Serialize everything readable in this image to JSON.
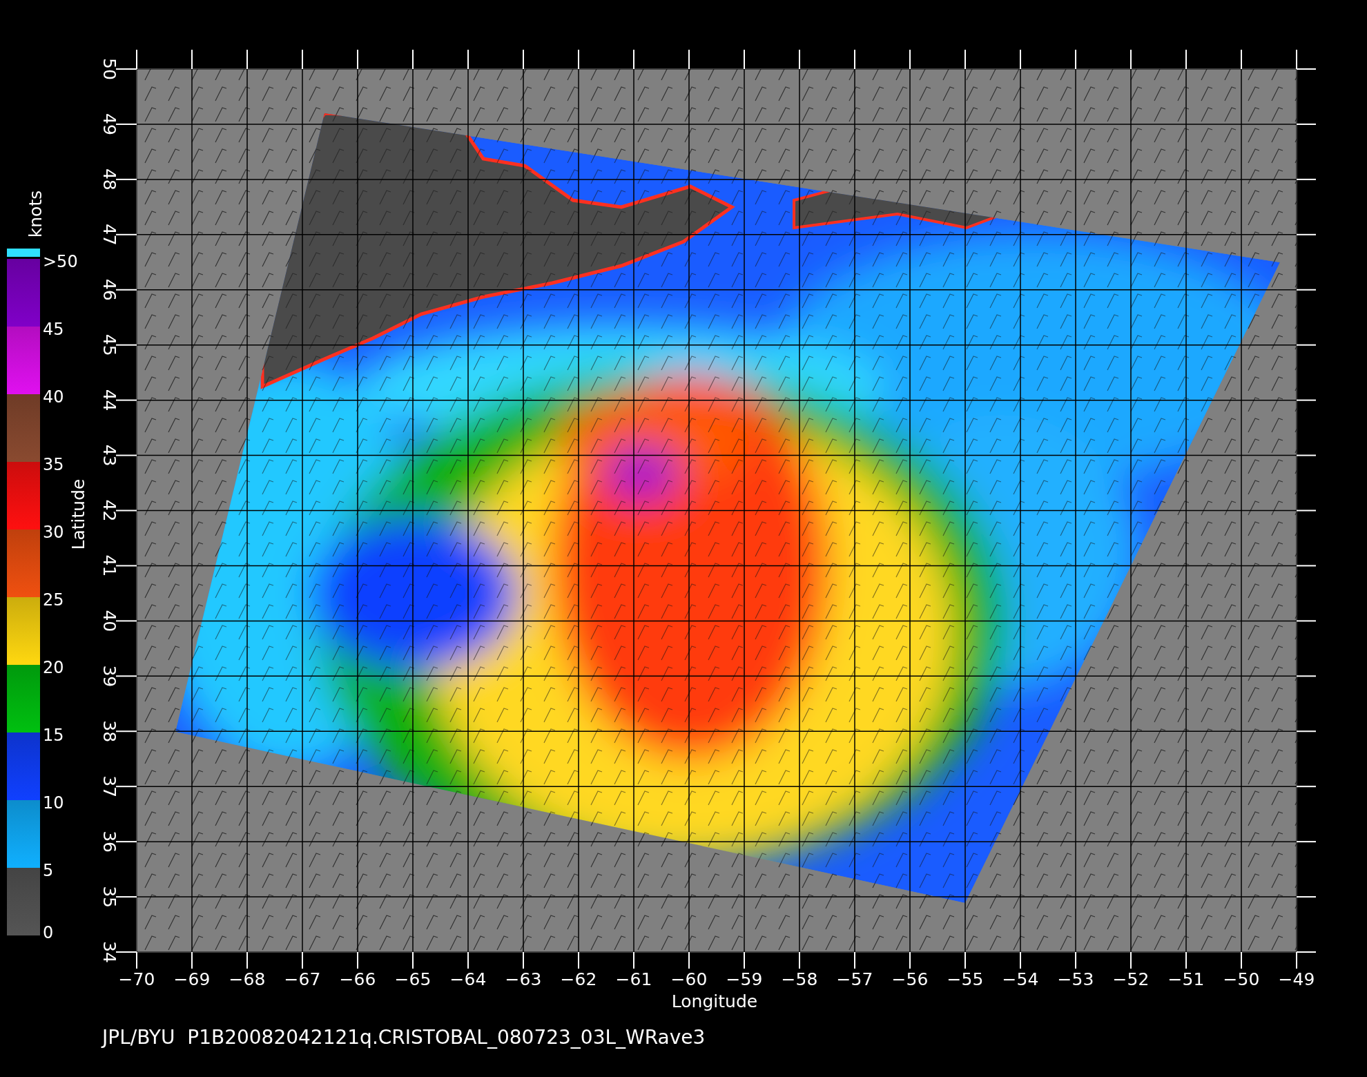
{
  "plot": {
    "x_axis": {
      "title": "Longitude",
      "ticks": [
        "−70",
        "−69",
        "−68",
        "−67",
        "−66",
        "−65",
        "−64",
        "−63",
        "−62",
        "−61",
        "−60",
        "−59",
        "−58",
        "−57",
        "−56",
        "−55",
        "−54",
        "−53",
        "−52",
        "−51",
        "−50",
        "−49"
      ]
    },
    "y_axis": {
      "title": "Latitude",
      "ticks": [
        "34",
        "35",
        "36",
        "37",
        "38",
        "39",
        "40",
        "41",
        "42",
        "43",
        "44",
        "45",
        "46",
        "47",
        "48",
        "49",
        "50"
      ]
    }
  },
  "colorbar": {
    "unit": "knots",
    "labels": [
      ">50",
      "45",
      "40",
      "35",
      "30",
      "25",
      "20",
      "15",
      "10",
      "5",
      "0"
    ],
    "bands": [
      {
        "color": "#8000c8"
      },
      {
        "color": "#e010f0"
      },
      {
        "color": "#8a4a30"
      },
      {
        "color": "#ff1010"
      },
      {
        "color": "#f05010"
      },
      {
        "color": "#ffd810"
      },
      {
        "color": "#00c010"
      },
      {
        "color": "#1040ff"
      },
      {
        "color": "#10b0ff"
      },
      {
        "color": "#555555"
      }
    ]
  },
  "footer": "JPL/BYU  P1B20082042121q.CRISTOBAL_080723_03L_WRave3"
}
